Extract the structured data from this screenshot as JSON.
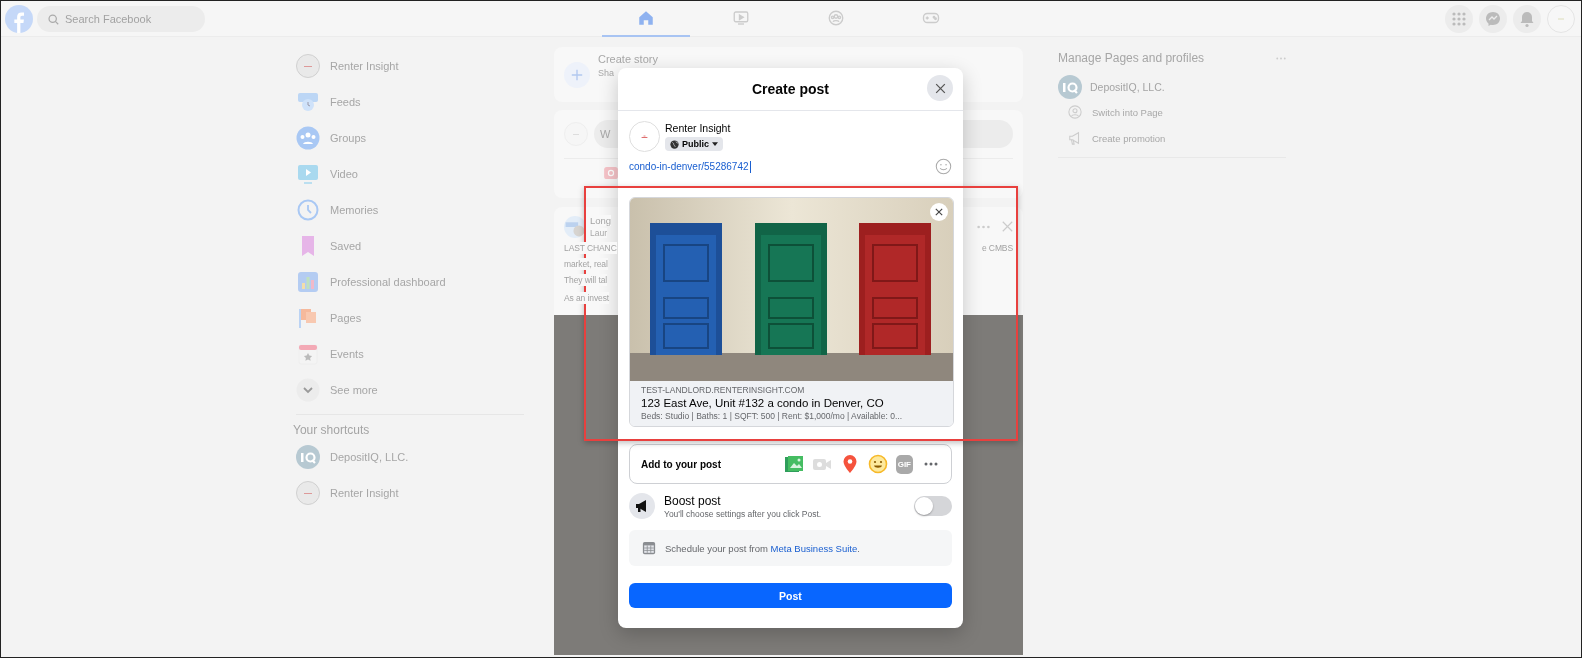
{
  "top_bar": {
    "search": {
      "placeholder": "Search Facebook"
    },
    "nav_tabs": [
      {
        "kind": "home",
        "selected": true
      },
      {
        "kind": "video",
        "selected": false
      },
      {
        "kind": "groups",
        "selected": false
      },
      {
        "kind": "gaming",
        "selected": false
      }
    ]
  },
  "left_sidebar": {
    "items": [
      {
        "label": "Renter Insight",
        "kind": "profile"
      },
      {
        "label": "Feeds",
        "kind": "feeds"
      },
      {
        "label": "Groups",
        "kind": "groups"
      },
      {
        "label": "Video",
        "kind": "video"
      },
      {
        "label": "Memories",
        "kind": "memories"
      },
      {
        "label": "Saved",
        "kind": "saved"
      },
      {
        "label": "Professional dashboard",
        "kind": "dashboard"
      },
      {
        "label": "Pages",
        "kind": "pages"
      },
      {
        "label": "Events",
        "kind": "events"
      },
      {
        "label": "See more",
        "kind": "more"
      }
    ],
    "shortcuts_title": "Your shortcuts",
    "shortcuts": [
      {
        "label": "DepositIQ, LLC.",
        "kind": "logo"
      },
      {
        "label": "Renter Insight",
        "kind": "profile"
      }
    ]
  },
  "feed": {
    "story_card": {
      "title": "Create story",
      "subtitle": "Sha"
    },
    "composer": {
      "placeholder": "W"
    },
    "post": {
      "author": "Long",
      "meta": "Laur",
      "lines": [
        {
          "left": "LAST CHANC",
          "right": "e CMBS"
        },
        {
          "left": "market, real"
        },
        {
          "left": "They will tal"
        }
      ],
      "footer": "As an invest"
    }
  },
  "right_sidebar": {
    "title": "Manage Pages and profiles",
    "page": {
      "name": "DepositIQ, LLC."
    },
    "actions": [
      {
        "label": "Switch into Page",
        "kind": "switch"
      },
      {
        "label": "Create promotion",
        "kind": "promote"
      }
    ]
  },
  "modal": {
    "title": "Create post",
    "author": "Renter Insight",
    "audience": "Public",
    "link_text": "condo-in-denver/55286742",
    "preview": {
      "domain": "TEST-LANDLORD.RENTERINSIGHT.COM",
      "title": "123 East Ave, Unit #132 a condo in Denver, CO",
      "description": "Beds: Studio | Baths: 1 | SQFT: 500 | Rent: $1,000/mo | Available: 0..."
    },
    "add_to_post": {
      "label": "Add to your post",
      "tools": [
        {
          "kind": "photo"
        },
        {
          "kind": "video"
        },
        {
          "kind": "location"
        },
        {
          "kind": "feeling"
        },
        {
          "kind": "gif",
          "label": "GIF"
        },
        {
          "kind": "more"
        }
      ]
    },
    "boost": {
      "title": "Boost post",
      "subtitle": "You'll choose settings after you click Post.",
      "on": false
    },
    "schedule": {
      "text": "Schedule your post from ",
      "link": "Meta Business Suite",
      "suffix": "."
    },
    "post_button": "Post"
  }
}
